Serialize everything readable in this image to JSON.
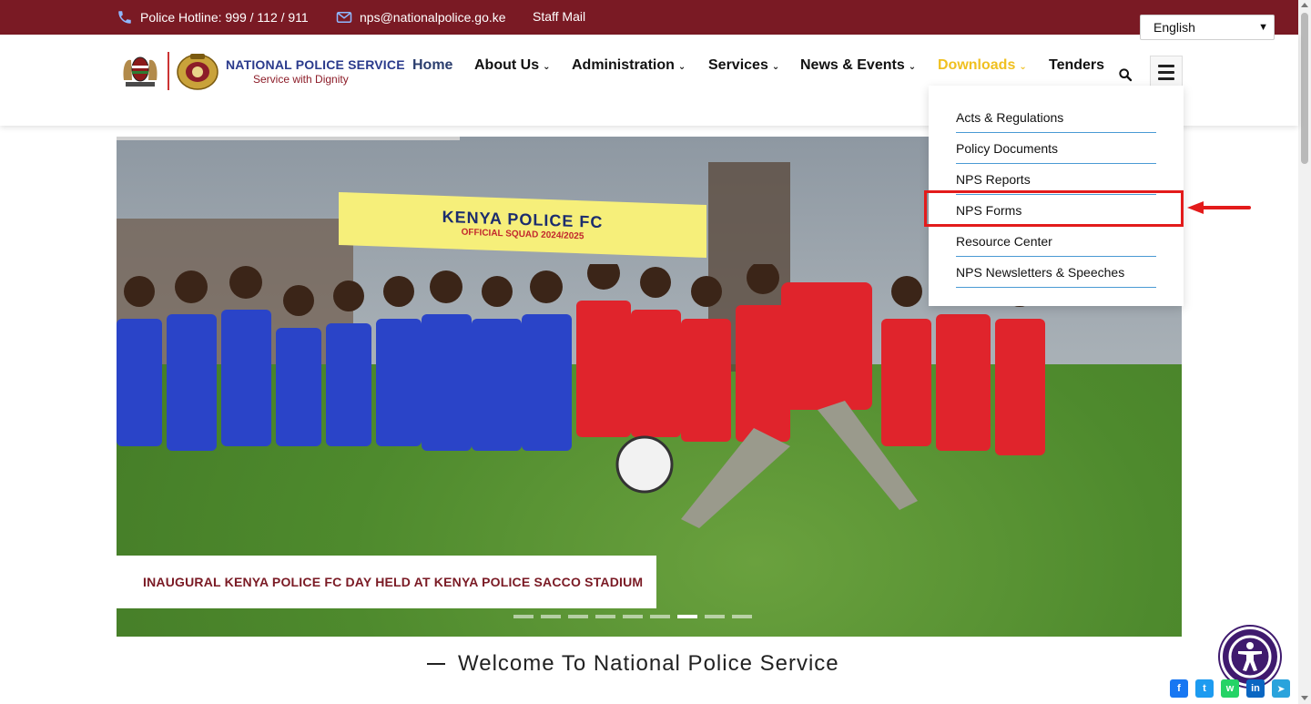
{
  "topbar": {
    "hotline": "Police Hotline: 999 / 112 / 911",
    "email": "nps@nationalpolice.go.ke",
    "staff_mail": "Staff Mail",
    "language": "English",
    "bg_color": "#7a1a24"
  },
  "logo": {
    "title": "NATIONAL POLICE SERVICE",
    "tagline": "Service with Dignity"
  },
  "nav": {
    "items": [
      {
        "label": "Home"
      },
      {
        "label": "About Us"
      },
      {
        "label": "Administration"
      },
      {
        "label": "Services"
      },
      {
        "label": "News & Events"
      },
      {
        "label": "Downloads"
      },
      {
        "label": "Tenders"
      }
    ],
    "active_color": "#f0c020"
  },
  "dropdown": {
    "items": [
      {
        "label": "Acts & Regulations"
      },
      {
        "label": "Policy Documents"
      },
      {
        "label": "NPS Reports"
      },
      {
        "label": "NPS Forms"
      },
      {
        "label": "Resource Center"
      },
      {
        "label": "NPS Newsletters & Speeches"
      }
    ],
    "highlighted": "NPS Forms"
  },
  "hero": {
    "banner_title": "KENYA POLICE FC",
    "banner_sub": "OFFICIAL SQUAD 2024/2025",
    "caption": "INAUGURAL KENYA POLICE FC DAY HELD AT KENYA POLICE SACCO STADIUM",
    "slide_count": 9,
    "active_slide": 7
  },
  "welcome": {
    "title": "Welcome To National Police Service"
  },
  "share": {
    "icons": [
      "facebook-icon",
      "twitter-icon",
      "whatsapp-icon",
      "linkedin-icon",
      "telegram-icon"
    ]
  }
}
